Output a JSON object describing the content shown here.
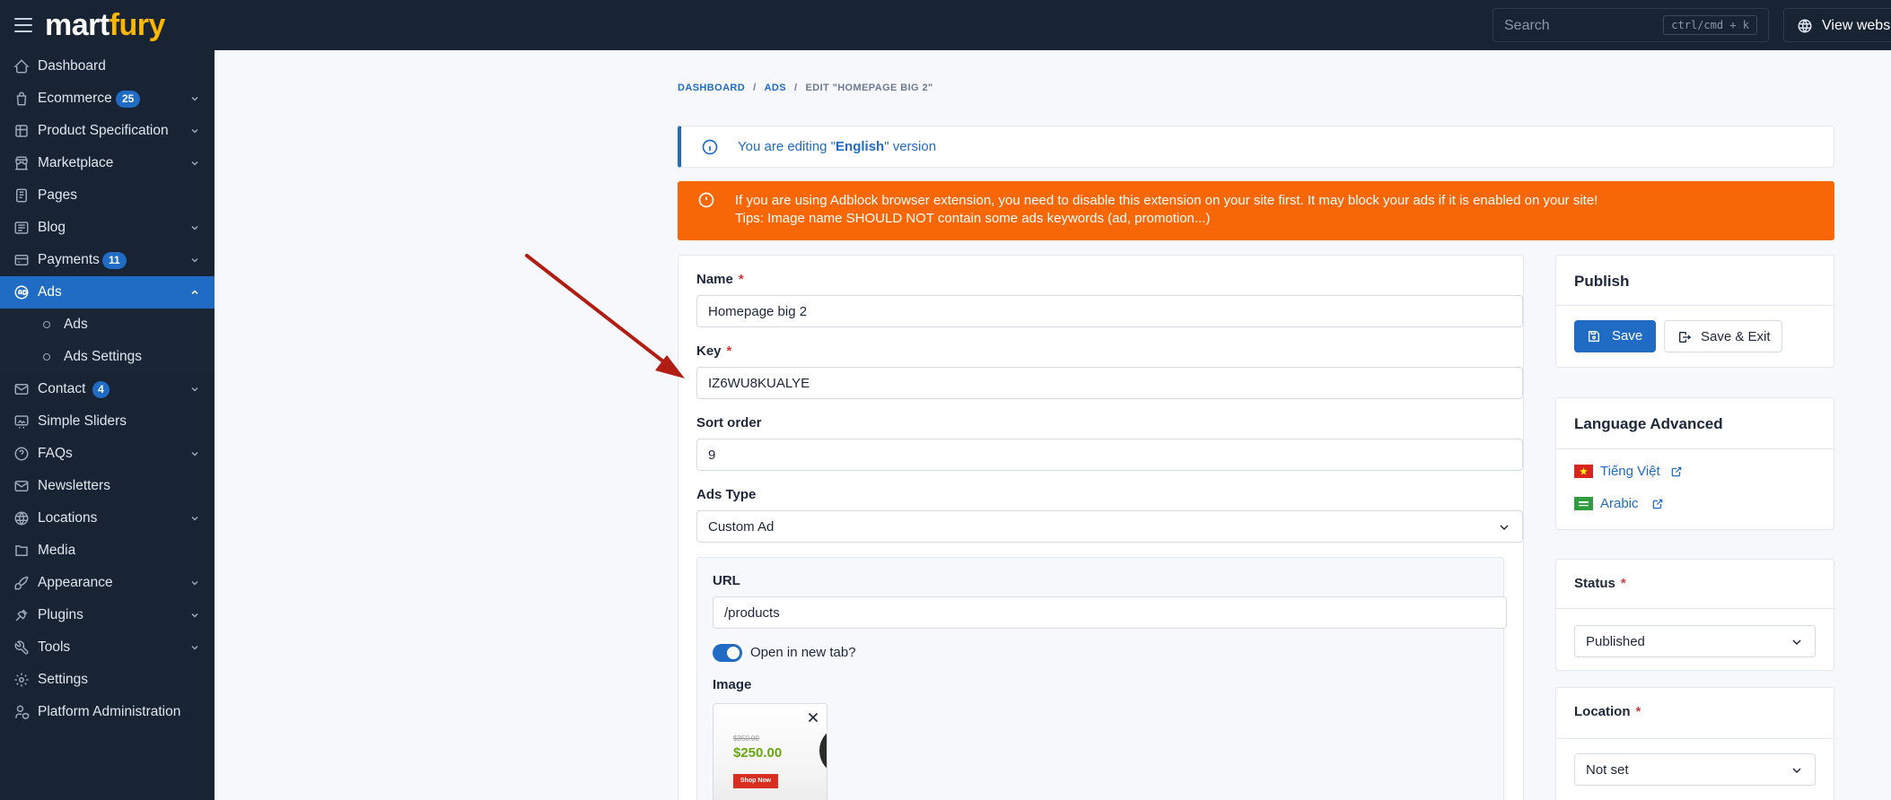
{
  "brand": {
    "logo_part1": "mart",
    "logo_part2": "fury"
  },
  "topbar": {
    "search_placeholder": "Search",
    "search_shortcut": "ctrl/cmd + k",
    "view_website": "View website"
  },
  "sidebar": {
    "items": [
      {
        "label": "Dashboard",
        "icon": "home-icon"
      },
      {
        "label": "Ecommerce",
        "badge": "25",
        "icon": "shopping-bag-icon"
      },
      {
        "label": "Product Specification",
        "icon": "table-icon"
      },
      {
        "label": "Marketplace",
        "icon": "store-icon"
      },
      {
        "label": "Pages",
        "icon": "page-icon"
      },
      {
        "label": "Blog",
        "icon": "article-icon"
      },
      {
        "label": "Payments",
        "badge": "11",
        "icon": "credit-card-icon"
      },
      {
        "label": "Ads",
        "icon": "ad-icon",
        "active": true
      },
      {
        "label": "Contact",
        "badge": "4",
        "icon": "mail-icon"
      },
      {
        "label": "Simple Sliders",
        "icon": "slideshow-icon"
      },
      {
        "label": "FAQs",
        "icon": "help-circle-icon"
      },
      {
        "label": "Newsletters",
        "icon": "mail-icon"
      },
      {
        "label": "Locations",
        "icon": "globe-icon"
      },
      {
        "label": "Media",
        "icon": "folder-icon"
      },
      {
        "label": "Appearance",
        "icon": "brush-icon"
      },
      {
        "label": "Plugins",
        "icon": "plug-icon"
      },
      {
        "label": "Tools",
        "icon": "tool-icon"
      },
      {
        "label": "Settings",
        "icon": "gear-icon"
      },
      {
        "label": "Platform Administration",
        "icon": "user-shield-icon"
      }
    ],
    "sub_items": [
      "Ads",
      "Ads Settings"
    ]
  },
  "breadcrumb": {
    "dashboard": "DASHBOARD",
    "ads": "ADS",
    "current": "EDIT \"HOMEPAGE BIG 2\""
  },
  "alerts": {
    "info_prefix": "You are editing \"",
    "info_lang": "English",
    "info_suffix": "\" version",
    "warn_line1": "If you are using Adblock browser extension, you need to disable this extension on your site first. It may block your ads if it is enabled on your site!",
    "warn_line2": "Tips: Image name SHOULD NOT contain some ads keywords (ad, promotion...)"
  },
  "form": {
    "name_label": "Name",
    "name_value": "Homepage big 2",
    "key_label": "Key",
    "key_value": "IZ6WU8KUALYE",
    "sort_label": "Sort order",
    "sort_value": "9",
    "type_label": "Ads Type",
    "type_value": "Custom Ad",
    "url_label": "URL",
    "url_value": "/products",
    "newtab_label": "Open in new tab?",
    "image_label": "Image",
    "required_mark": "*",
    "thumb_old_price": "$350.00",
    "thumb_price": "$250.00",
    "thumb_button": "Shop Now"
  },
  "publish": {
    "title": "Publish",
    "save": "Save",
    "save_exit": "Save & Exit"
  },
  "language": {
    "title": "Language Advanced",
    "items": [
      "Tiếng Việt",
      "Arabic"
    ]
  },
  "status": {
    "label": "Status",
    "value": "Published"
  },
  "location": {
    "label": "Location",
    "value": "Not set"
  },
  "colors": {
    "primary": "#206bc4",
    "warning": "#f76707",
    "sidebar": "#182433",
    "danger": "#d63939"
  }
}
